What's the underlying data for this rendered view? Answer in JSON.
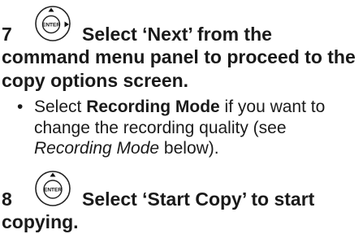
{
  "step7": {
    "number": "7",
    "icon": "enter-right-button-icon",
    "headline": "Select ‘Next’ from the",
    "body_line1": "command menu panel to proceed to the",
    "body_line2": "copy options screen.",
    "bullet": {
      "dot": "•",
      "text1": "Select ",
      "bold1": "Recording Mode",
      "text2": " if you want to",
      "line2": "change the recording quality (see",
      "italic1": "Recording Mode",
      "text3": " below)."
    }
  },
  "step8": {
    "number": "8",
    "icon": "enter-button-icon",
    "headline": "Select ‘Start Copy’ to start",
    "body_line1": "copying."
  }
}
